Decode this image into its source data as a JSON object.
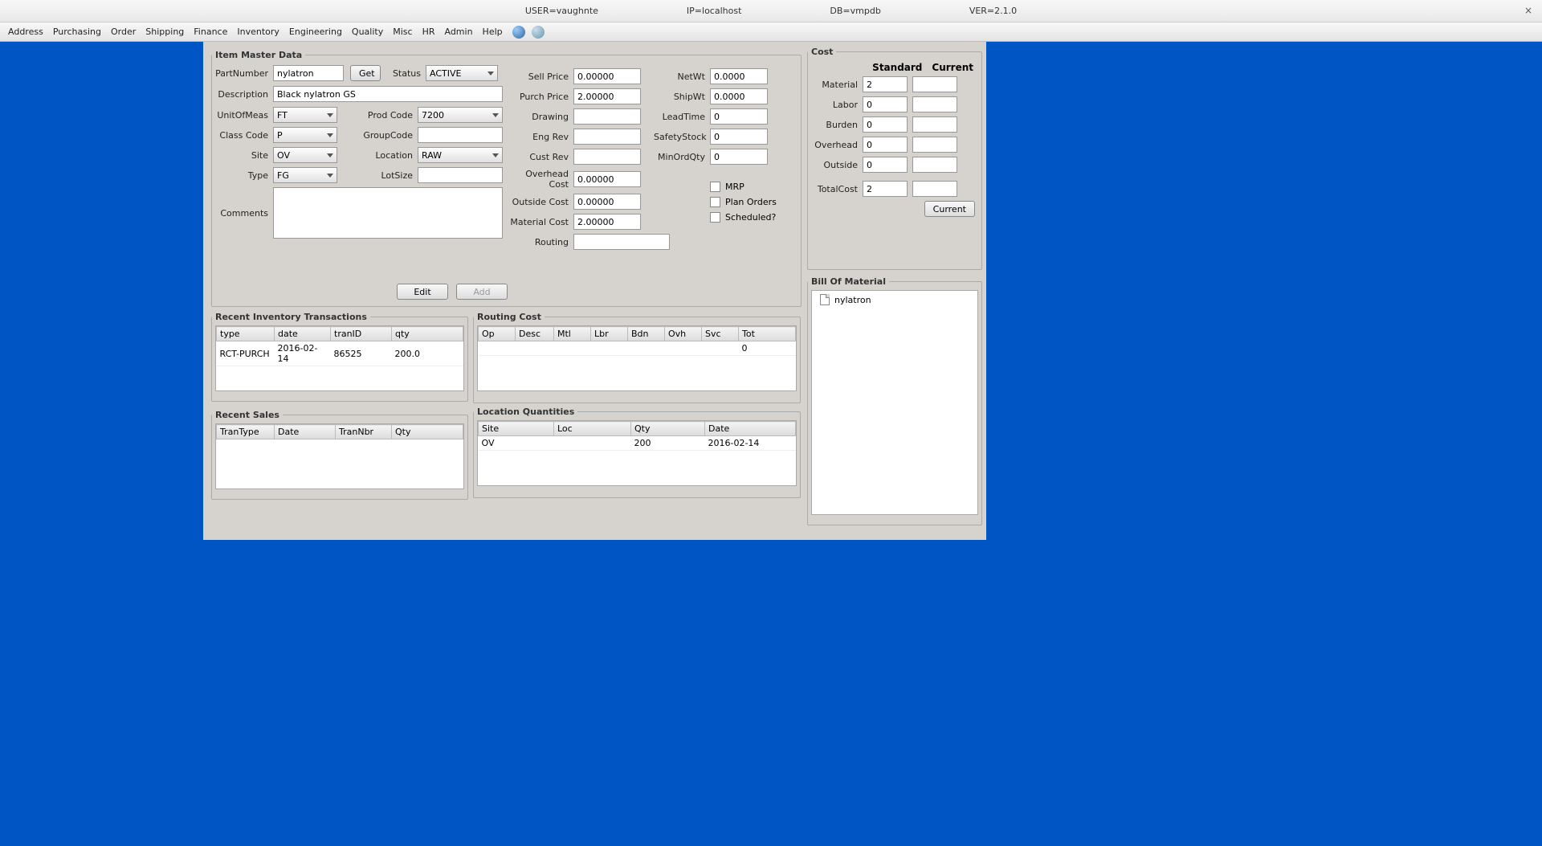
{
  "titlebar": {
    "user": "USER=vaughnte",
    "ip": "IP=localhost",
    "db": "DB=vmpdb",
    "ver": "VER=2.1.0"
  },
  "menu": [
    "Address",
    "Purchasing",
    "Order",
    "Shipping",
    "Finance",
    "Inventory",
    "Engineering",
    "Quality",
    "Misc",
    "HR",
    "Admin",
    "Help"
  ],
  "item": {
    "legend": "Item Master Data",
    "labels": {
      "partnumber": "PartNumber",
      "get": "Get",
      "status": "Status",
      "description": "Description",
      "uom": "UnitOfMeas",
      "prodcode": "Prod Code",
      "classcode": "Class Code",
      "groupcode": "GroupCode",
      "site": "Site",
      "location": "Location",
      "type": "Type",
      "lotsize": "LotSize",
      "comments": "Comments",
      "sellprice": "Sell Price",
      "purchprice": "Purch Price",
      "drawing": "Drawing",
      "engrev": "Eng Rev",
      "custrev": "Cust Rev",
      "overhead": "Overhead Cost",
      "outside": "Outside Cost",
      "material": "Material Cost",
      "routing": "Routing",
      "netwt": "NetWt",
      "shipwt": "ShipWt",
      "leadtime": "LeadTime",
      "safetystock": "SafetyStock",
      "minordqty": "MinOrdQty",
      "mrp": "MRP",
      "planorders": "Plan Orders",
      "scheduled": "Scheduled?",
      "edit": "Edit",
      "add": "Add"
    },
    "values": {
      "partnumber": "nylatron",
      "status": "ACTIVE",
      "description": "Black nylatron GS",
      "uom": "FT",
      "prodcode": "7200",
      "classcode": "P",
      "groupcode": "",
      "site": "OV",
      "location": "RAW",
      "type": "FG",
      "lotsize": "",
      "comments": "",
      "sellprice": "0.00000",
      "purchprice": "2.00000",
      "drawing": "",
      "engrev": "",
      "custrev": "",
      "overhead": "0.00000",
      "outside": "0.00000",
      "material": "2.00000",
      "routing": "",
      "netwt": "0.0000",
      "shipwt": "0.0000",
      "leadtime": "0",
      "safetystock": "0",
      "minordqty": "0"
    }
  },
  "cost": {
    "legend": "Cost",
    "header_std": "Standard",
    "header_cur": "Current",
    "labels": {
      "material": "Material",
      "labor": "Labor",
      "burden": "Burden",
      "overhead": "Overhead",
      "outside": "Outside",
      "total": "TotalCost",
      "current_btn": "Current"
    },
    "std": {
      "material": "2",
      "labor": "0",
      "burden": "0",
      "overhead": "0",
      "outside": "0",
      "total": "2"
    },
    "cur": {
      "material": "",
      "labor": "",
      "burden": "",
      "overhead": "",
      "outside": "",
      "total": ""
    }
  },
  "bom": {
    "legend": "Bill Of Material",
    "root": "nylatron"
  },
  "inv": {
    "legend": "Recent Inventory Transactions",
    "headers": [
      "type",
      "date",
      "tranID",
      "qty"
    ],
    "rows": [
      [
        "RCT-PURCH",
        "2016-02-14",
        "86525",
        "200.0"
      ]
    ]
  },
  "routingcost": {
    "legend": "Routing Cost",
    "headers": [
      "Op",
      "Desc",
      "Mtl",
      "Lbr",
      "Bdn",
      "Ovh",
      "Svc",
      "Tot"
    ],
    "rows": [
      [
        "",
        "",
        "",
        "",
        "",
        "",
        "",
        "0"
      ]
    ]
  },
  "sales": {
    "legend": "Recent Sales",
    "headers": [
      "TranType",
      "Date",
      "TranNbr",
      "Qty"
    ],
    "rows": []
  },
  "locqty": {
    "legend": "Location Quantities",
    "headers": [
      "Site",
      "Loc",
      "Qty",
      "Date"
    ],
    "rows": [
      [
        "OV",
        "",
        "200",
        "2016-02-14"
      ]
    ]
  }
}
